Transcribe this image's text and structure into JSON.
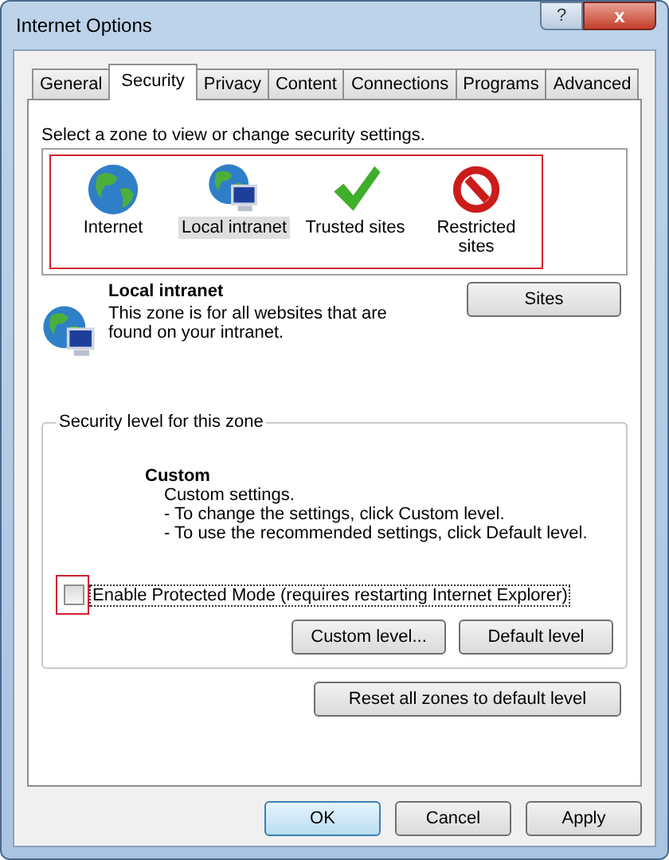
{
  "window": {
    "title": "Internet Options",
    "help": "?",
    "close": "x"
  },
  "tabs": [
    {
      "label": "General",
      "selected": false
    },
    {
      "label": "Security",
      "selected": true
    },
    {
      "label": "Privacy",
      "selected": false
    },
    {
      "label": "Content",
      "selected": false
    },
    {
      "label": "Connections",
      "selected": false
    },
    {
      "label": "Programs",
      "selected": false
    },
    {
      "label": "Advanced",
      "selected": false
    }
  ],
  "zone_prompt": "Select a zone to view or change security settings.",
  "zones": [
    {
      "kind": "globe",
      "label": "Internet",
      "selected": false
    },
    {
      "kind": "intranet",
      "label": "Local intranet",
      "selected": true
    },
    {
      "kind": "check",
      "label": "Trusted sites",
      "selected": false
    },
    {
      "kind": "blocked",
      "label": "Restricted sites",
      "selected": false
    }
  ],
  "zone_info": {
    "kind": "intranet",
    "title": "Local intranet",
    "description": "This zone is for all websites that are found on your intranet.",
    "button": "Sites"
  },
  "security_level": {
    "legend": "Security level for this zone",
    "title": "Custom",
    "lines": [
      "Custom settings.",
      "- To change the settings, click Custom level.",
      "- To use the recommended settings, click Default level."
    ],
    "protected_mode": {
      "label": "Enable Protected Mode (requires restarting Internet Explorer)",
      "checked": false
    },
    "buttons": [
      "Custom level...",
      "Default level"
    ]
  },
  "reset_button": "Reset all zones to default level",
  "dialog_buttons": [
    {
      "label": "OK",
      "default": true
    },
    {
      "label": "Cancel",
      "default": false
    },
    {
      "label": "Apply",
      "default": false
    }
  ]
}
